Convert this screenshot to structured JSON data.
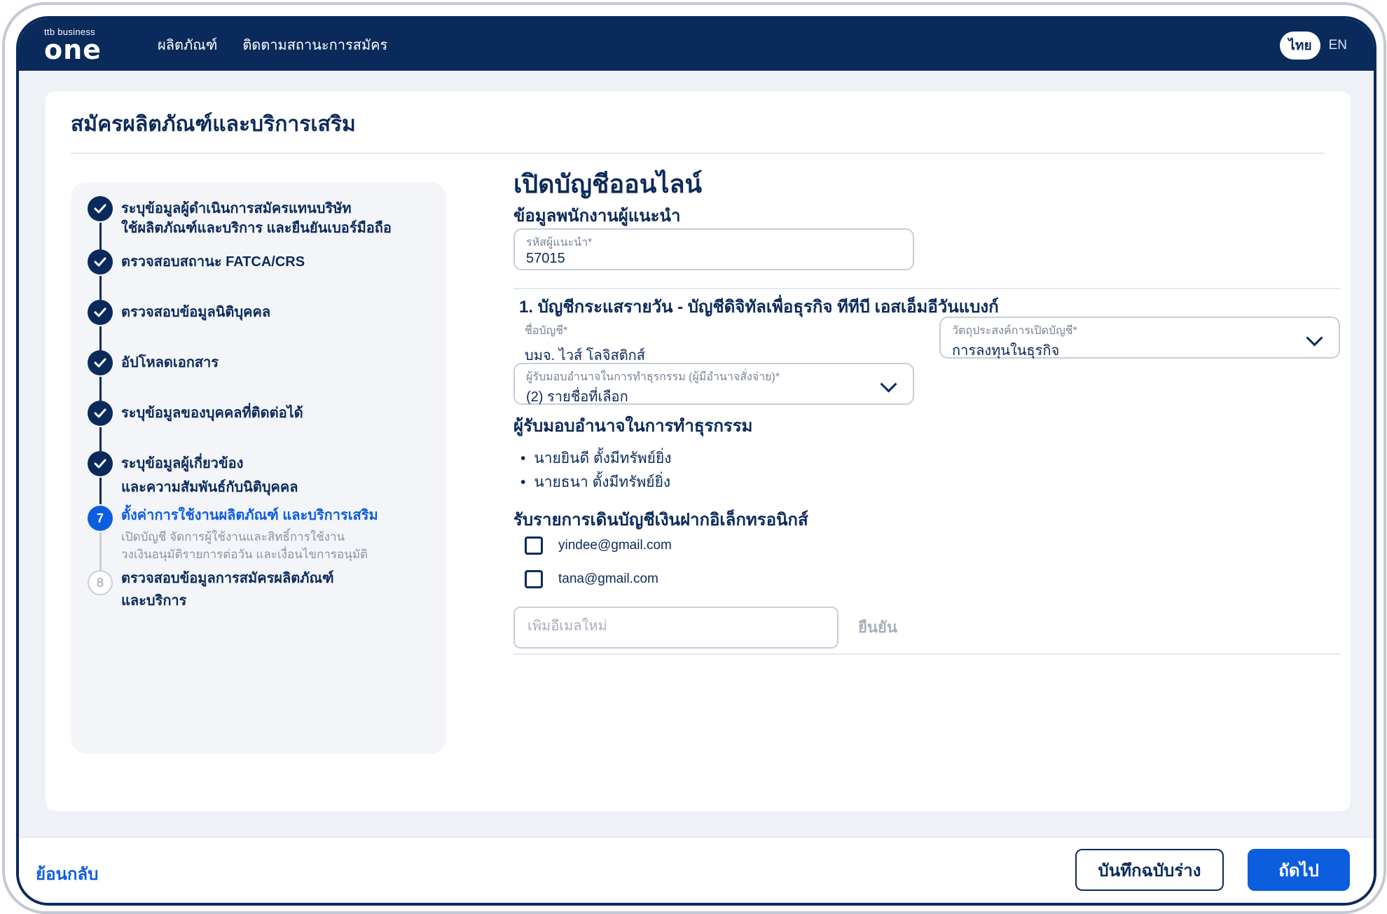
{
  "header": {
    "logo_small": "ttb business",
    "logo_big": "one",
    "nav": [
      "ผลิตภัณฑ์",
      "ติดตามสถานะการสมัคร"
    ],
    "lang_active": "ไทย",
    "lang_other": "EN"
  },
  "page": {
    "title": "สมัครผลิตภัณฑ์และบริการเสริม"
  },
  "stepper": {
    "steps": [
      {
        "label_line1": "ระบุข้อมูลผู้ดำเนินการสมัครแทนบริษัท",
        "label_line2": "ใช้ผลิตภัณฑ์และบริการ และยืนยันเบอร์มือถือ",
        "status": "done"
      },
      {
        "label_line1": "ตรวจสอบสถานะ FATCA/CRS",
        "status": "done"
      },
      {
        "label_line1": "ตรวจสอบข้อมูลนิติบุคคล",
        "status": "done"
      },
      {
        "label_line1": "อัปโหลดเอกสาร",
        "status": "done"
      },
      {
        "label_line1": "ระบุข้อมูลของบุคคลที่ติดต่อได้",
        "status": "done"
      },
      {
        "label_line1": "ระบุข้อมูลผู้เกี่ยวข้อง",
        "label_line2": "และความสัมพันธ์กับนิติบุคคล",
        "status": "done"
      },
      {
        "number": "7",
        "label_line1": "ตั้งค่าการใช้งานผลิตภัณฑ์ และบริการเสริม",
        "desc_line1": "เปิดบัญชี จัดการผู้ใช้งานและสิทธิ์การใช้งาน",
        "desc_line2": "วงเงินอนุมัติรายการต่อวัน และเงื่อนไขการอนุมัติ",
        "status": "active"
      },
      {
        "number": "8",
        "label_line1": "ตรวจสอบข้อมูลการสมัครผลิตภัณฑ์",
        "label_line2": "และบริการ",
        "status": "pending"
      }
    ]
  },
  "form": {
    "heading": "เปิดบัญชีออนไลน์",
    "referrer_section": "ข้อมูลพนักงานผู้แนะนำ",
    "referrer_code_label": "รหัสผู้แนะนำ*",
    "referrer_code_value": "57015",
    "account_title": "1. บัญชีกระแสรายวัน - บัญชีดิจิทัลเพื่อธุรกิจ ทีทีบี เอสเอ็มอีวันแบงก์",
    "account_name_label": "ชื่อบัญชี*",
    "account_name_value": "บมจ. ไวส์ โลจิสติกส์",
    "purpose_label": "วัตถุประสงค์การเปิดบัญชี*",
    "purpose_value": "การลงทุนในธุรกิจ",
    "authorized_label": "ผู้รับมอบอำนาจในการทำธุรกรรม (ผู้มีอำนาจสั่งจ่าย)*",
    "authorized_value": "(2) รายชื่อที่เลือก",
    "authorized_section": "ผู้รับมอบอำนาจในการทำธุรกรรม",
    "authorized_people": [
      "นายยินดี ตั้งมีทรัพย์ยิ่ง",
      "นายธนา ตั้งมีทรัพย์ยิ่ง"
    ],
    "estatement_section": "รับรายการเดินบัญชีเงินฝากอิเล็กทรอนิกส์",
    "emails": [
      "yindee@gmail.com",
      "tana@gmail.com"
    ],
    "new_email_placeholder": "เพิ่มอีเมลใหม่",
    "confirm_label": "ยืนยัน"
  },
  "footer": {
    "back_label": "ย้อนกลับ",
    "save_draft_label": "บันทึกฉบับร่าง",
    "next_label": "ถัดไป"
  },
  "colors": {
    "brand_navy": "#0a2a5b",
    "accent_blue": "#0d5ddf",
    "surface": "#eef1f5"
  }
}
